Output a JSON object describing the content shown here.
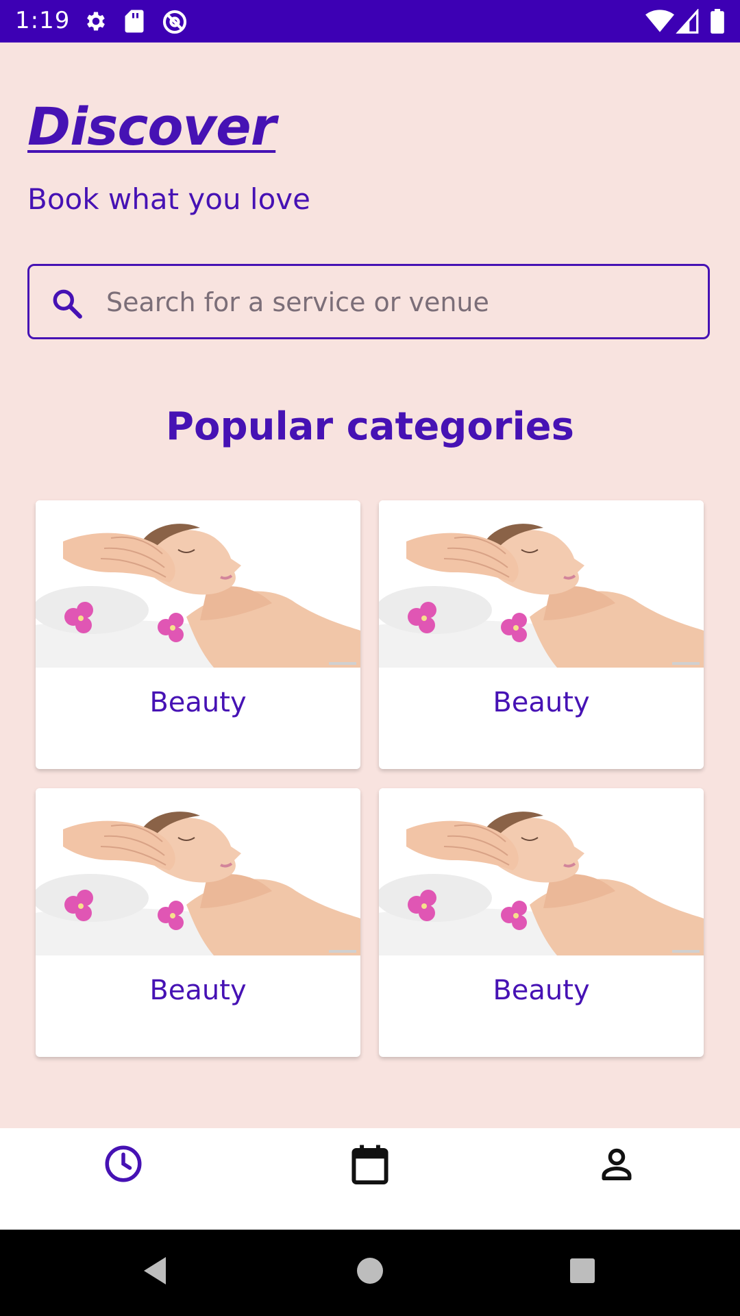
{
  "status_bar": {
    "time": "1:19",
    "left_icons": [
      "gear-icon",
      "sd-card-icon",
      "vpn-key-icon"
    ],
    "right_icons": [
      "wifi-icon",
      "cellular-signal-icon",
      "battery-icon"
    ],
    "color": "#3d00b4"
  },
  "header": {
    "title": "Discover",
    "subtitle": "Book what you love"
  },
  "search": {
    "placeholder": "Search for a service or venue",
    "value": ""
  },
  "section": {
    "title": "Popular categories"
  },
  "categories": [
    {
      "label": "Beauty"
    },
    {
      "label": "Beauty"
    },
    {
      "label": "Beauty"
    },
    {
      "label": "Beauty"
    }
  ],
  "bottom_nav": {
    "items": [
      "clock-icon",
      "calendar-icon",
      "person-icon"
    ]
  },
  "system_nav": [
    "back-icon",
    "home-icon",
    "recents-icon"
  ],
  "colors": {
    "accent": "#4612b4",
    "background": "#f8e3df"
  }
}
